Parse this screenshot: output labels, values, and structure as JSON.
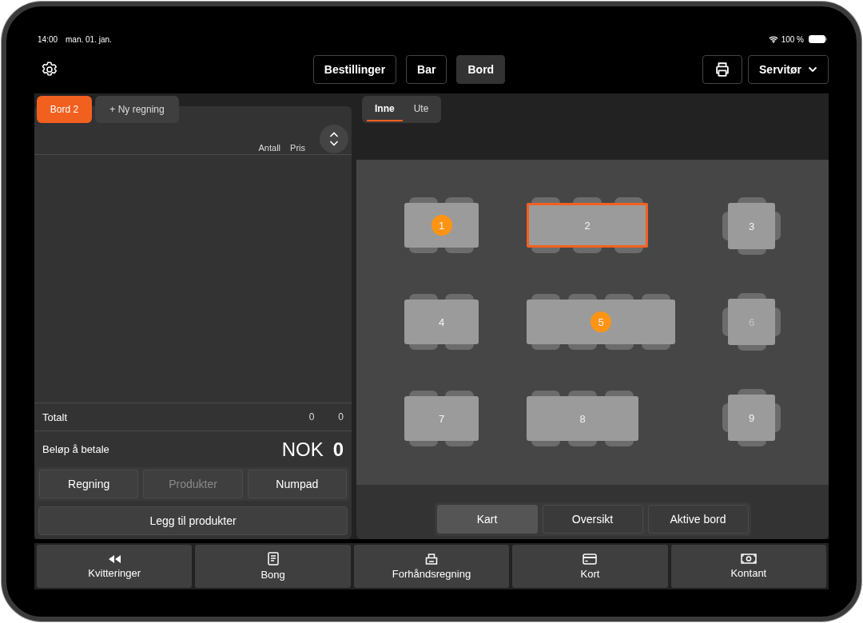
{
  "status_bar": {
    "time": "14:00",
    "date": "man. 01. jan.",
    "battery": "100 %"
  },
  "top_bar": {
    "nav": [
      {
        "label": "Bestillinger",
        "selected": false
      },
      {
        "label": "Bar",
        "selected": false
      },
      {
        "label": "Bord",
        "selected": true
      }
    ],
    "waiter": "Servitør"
  },
  "bill": {
    "tabs": [
      {
        "label": "Bord 2",
        "selected": true
      },
      {
        "label": "+ Ny regning",
        "selected": false
      }
    ],
    "columns": [
      "Antall",
      "Pris"
    ],
    "total": {
      "label": "Totalt",
      "count": "0",
      "price": "0"
    },
    "amount": {
      "label": "Beløp å betale",
      "currency": "NOK",
      "value": "0"
    },
    "modes": [
      {
        "label": "Regning",
        "disabled": false
      },
      {
        "label": "Produkter",
        "disabled": true
      },
      {
        "label": "Numpad",
        "disabled": false
      }
    ],
    "add_button": "Legg til produkter"
  },
  "floor": {
    "areas": [
      {
        "label": "Inne",
        "selected": true
      },
      {
        "label": "Ute",
        "selected": false
      }
    ],
    "tables": [
      {
        "label": "1",
        "selected": false,
        "occupied": true,
        "inactive": false
      },
      {
        "label": "2",
        "selected": true,
        "occupied": false,
        "inactive": false
      },
      {
        "label": "3",
        "selected": false,
        "occupied": false,
        "inactive": false
      },
      {
        "label": "4",
        "selected": false,
        "occupied": false,
        "inactive": false
      },
      {
        "label": "5",
        "selected": false,
        "occupied": true,
        "inactive": false
      },
      {
        "label": "6",
        "selected": false,
        "occupied": false,
        "inactive": true
      },
      {
        "label": "7",
        "selected": false,
        "occupied": false,
        "inactive": false
      },
      {
        "label": "8",
        "selected": false,
        "occupied": false,
        "inactive": false
      },
      {
        "label": "9",
        "selected": false,
        "occupied": false,
        "inactive": false
      }
    ],
    "views": [
      {
        "label": "Kart",
        "selected": true
      },
      {
        "label": "Oversikt",
        "selected": false
      },
      {
        "label": "Aktive bord",
        "selected": false
      }
    ]
  },
  "actions": [
    {
      "label": "Kvitteringer",
      "kind": "rewind"
    },
    {
      "label": "Bong",
      "kind": "receipt"
    },
    {
      "label": "Forhåndsregning",
      "kind": "printer"
    },
    {
      "label": "Kort",
      "kind": "card"
    },
    {
      "label": "Kontant",
      "kind": "cash"
    }
  ]
}
